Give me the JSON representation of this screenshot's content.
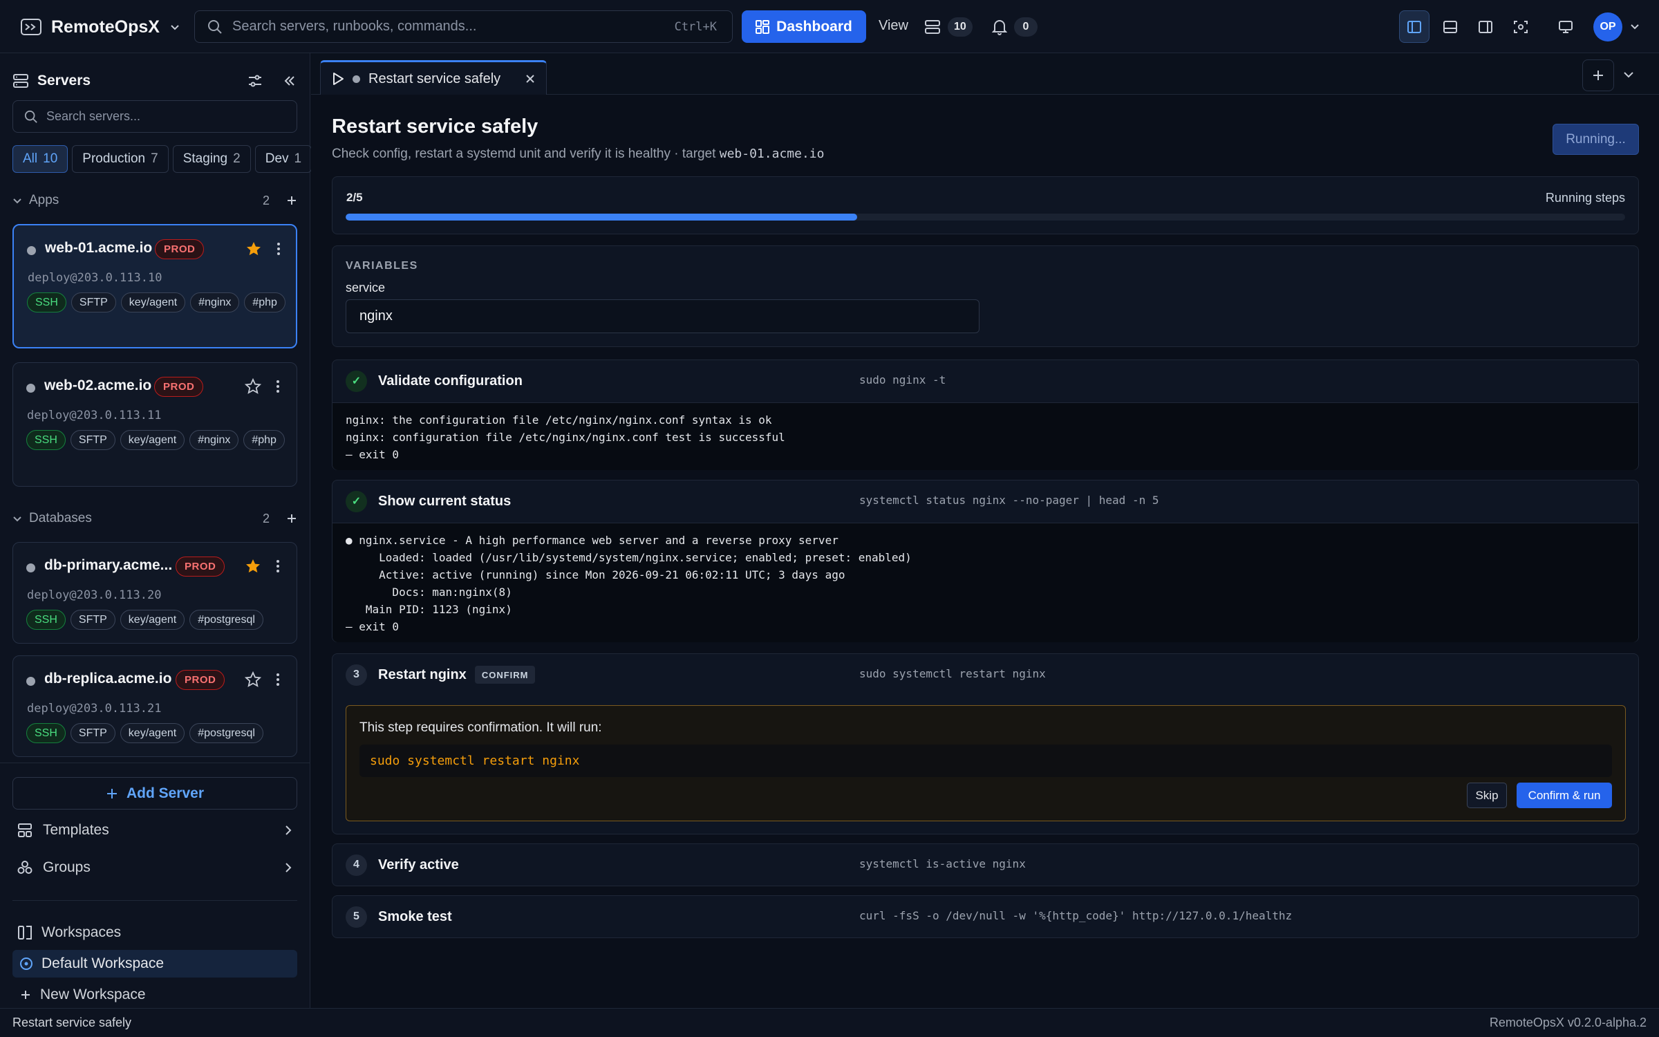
{
  "app": {
    "name": "RemoteOpsX",
    "version": "RemoteOpsX v0.2.0-alpha.2"
  },
  "topbar": {
    "search_placeholder": "Search servers, runbooks, commands...",
    "search_shortcut": "Ctrl+K",
    "dashboard_label": "Dashboard",
    "view_label": "View",
    "servers_count": "10",
    "notifications_count": "0",
    "avatar_initials": "OP",
    "accent": "#2563eb"
  },
  "sidebar": {
    "title": "Servers",
    "search_placeholder": "Search servers...",
    "filters": [
      {
        "label": "All",
        "count": "10",
        "active": true
      },
      {
        "label": "Production",
        "count": "7"
      },
      {
        "label": "Staging",
        "count": "2"
      },
      {
        "label": "Dev",
        "count": "1"
      }
    ],
    "groups": [
      {
        "label": "Apps",
        "count": "2"
      },
      {
        "label": "Databases",
        "count": "2"
      }
    ],
    "servers": [
      {
        "host": "web-01.acme.io",
        "env": "PROD",
        "user": "deploy@203.0.113.10",
        "starred": true,
        "selected": true,
        "tags": [
          "SSH",
          "SFTP",
          "key/agent",
          "#nginx",
          "#php"
        ]
      },
      {
        "host": "web-02.acme.io",
        "env": "PROD",
        "user": "deploy@203.0.113.11",
        "starred": false,
        "tags": [
          "SSH",
          "SFTP",
          "key/agent",
          "#nginx",
          "#php"
        ]
      },
      {
        "host": "db-primary.acme...",
        "env": "PROD",
        "user": "deploy@203.0.113.20",
        "starred": true,
        "tags": [
          "SSH",
          "SFTP",
          "key/agent",
          "#postgresql"
        ]
      },
      {
        "host": "db-replica.acme.io",
        "env": "PROD",
        "user": "deploy@203.0.113.21",
        "starred": false,
        "tags": [
          "SSH",
          "SFTP",
          "key/agent",
          "#postgresql"
        ]
      }
    ],
    "add_server_label": "Add Server",
    "nav": [
      {
        "label": "Templates"
      },
      {
        "label": "Groups"
      }
    ],
    "workspaces": {
      "title": "Workspaces",
      "items": [
        {
          "label": "Default Workspace",
          "active": true
        }
      ],
      "new_label": "New Workspace"
    }
  },
  "tab": {
    "label": "Restart service safely"
  },
  "runbook": {
    "title": "Restart service safely",
    "description": "Check config, restart a systemd unit and verify it is healthy · target",
    "target": "web-01.acme.io",
    "run_status_button": "Running...",
    "progress": {
      "label": "2/5",
      "status": "Running steps",
      "fraction": 0.4
    },
    "variables": {
      "heading": "VARIABLES",
      "name": "service",
      "value": "nginx"
    },
    "steps": [
      {
        "num": "✓",
        "title": "Validate configuration",
        "command": "sudo nginx -t",
        "state": "done",
        "output": "nginx: the configuration file /etc/nginx/nginx.conf syntax is ok\nnginx: configuration file /etc/nginx/nginx.conf test is successful\n— exit 0"
      },
      {
        "num": "✓",
        "title": "Show current status",
        "command": "systemctl status nginx --no-pager | head -n 5",
        "state": "done",
        "output": "● nginx.service - A high performance web server and a reverse proxy server\n     Loaded: loaded (/usr/lib/systemd/system/nginx.service; enabled; preset: enabled)\n     Active: active (running) since Mon 2026-09-21 06:02:11 UTC; 3 days ago\n       Docs: man:nginx(8)\n   Main PID: 1123 (nginx)\n— exit 0"
      },
      {
        "num": "3",
        "title": "Restart nginx",
        "badge": "CONFIRM",
        "command": "sudo systemctl restart nginx",
        "state": "confirm",
        "confirm_message": "This step requires confirmation. It will run:",
        "confirm_command": "sudo systemctl restart nginx",
        "skip_label": "Skip",
        "confirm_label": "Confirm & run"
      },
      {
        "num": "4",
        "title": "Verify active",
        "command": "systemctl is-active nginx",
        "state": "pending"
      },
      {
        "num": "5",
        "title": "Smoke test",
        "command": "curl -fsS -o /dev/null -w '%{http_code}' http://127.0.0.1/healthz",
        "state": "pending"
      }
    ]
  },
  "statusbar": {
    "left": "Restart service safely"
  }
}
